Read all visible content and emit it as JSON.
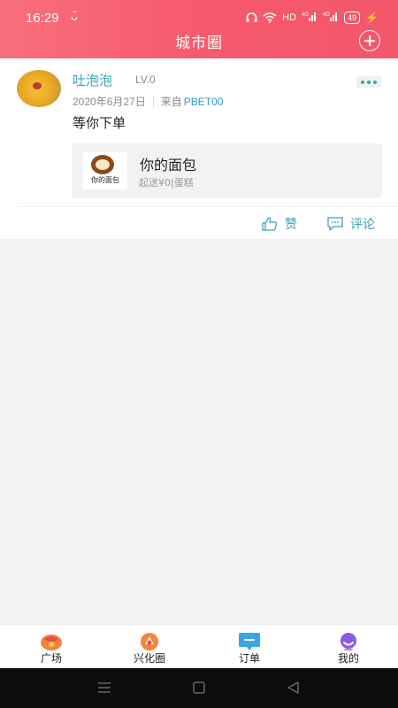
{
  "status_bar": {
    "time": "16:29",
    "notification": "ᴗ̈",
    "network": "HD",
    "signal1": "4G",
    "signal2": "4G",
    "battery": "49"
  },
  "header": {
    "title": "城市圈"
  },
  "post": {
    "username": "吐泡泡",
    "level": "LV.0",
    "date": "2020年6月27日",
    "source_prefix": "来自",
    "device": "PBET00",
    "content": "等你下单",
    "shop": {
      "logo_text": "你的面包",
      "name": "你的面包",
      "subtitle": "起送¥0|蛋糕"
    },
    "like_label": "赞",
    "comment_label": "评论"
  },
  "tabbar": {
    "items": [
      {
        "label": "广场",
        "icon": "plaza-icon",
        "color": "#f05a5a"
      },
      {
        "label": "兴化圈",
        "icon": "circle-icon",
        "color": "#f07a3a"
      },
      {
        "label": "订单",
        "icon": "order-icon",
        "color": "#3aa6e6"
      },
      {
        "label": "我的",
        "icon": "profile-icon",
        "color": "#8b5ae6"
      }
    ]
  },
  "colors": {
    "header_bg": "#f65a6d",
    "accent_teal": "#3aa3b4",
    "link_blue": "#2e9bd6",
    "page_bg": "#f2f1f4"
  }
}
